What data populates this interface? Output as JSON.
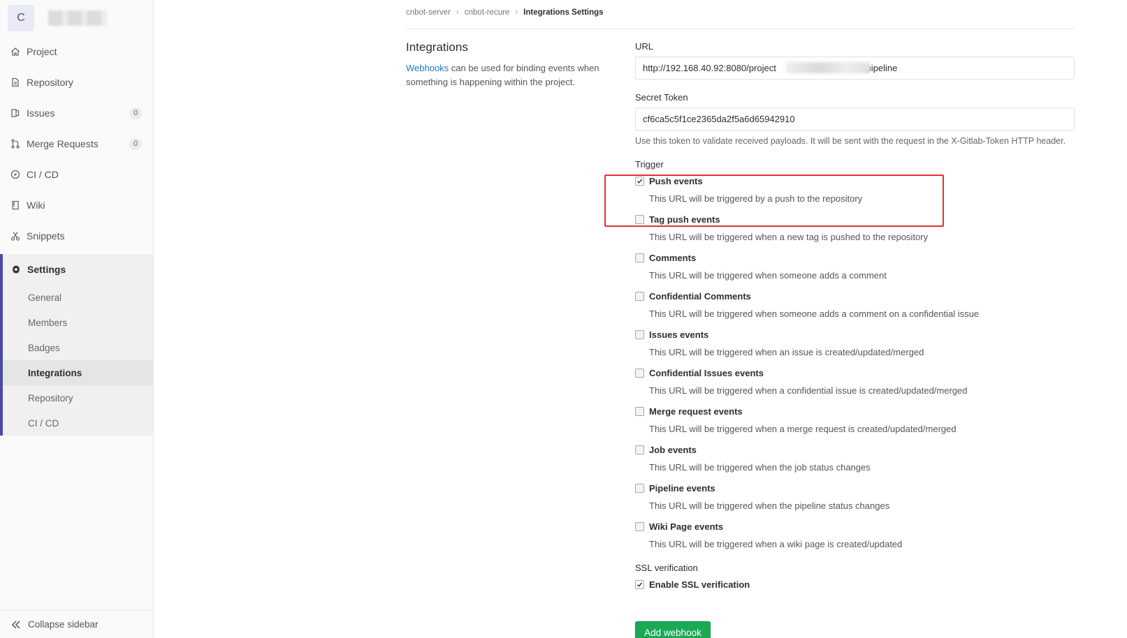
{
  "sidebar": {
    "avatar_letter": "C",
    "items": [
      {
        "label": "Project",
        "icon": "home-icon"
      },
      {
        "label": "Repository",
        "icon": "doc-icon"
      },
      {
        "label": "Issues",
        "icon": "issues-icon",
        "badge": "0"
      },
      {
        "label": "Merge Requests",
        "icon": "merge-icon",
        "badge": "0"
      },
      {
        "label": "CI / CD",
        "icon": "rocket-icon"
      },
      {
        "label": "Wiki",
        "icon": "book-icon"
      },
      {
        "label": "Snippets",
        "icon": "scissors-icon"
      }
    ],
    "settings": {
      "label": "Settings",
      "icon": "gear-icon",
      "sub_items": [
        "General",
        "Members",
        "Badges",
        "Integrations",
        "Repository",
        "CI / CD"
      ],
      "active_index": 3
    },
    "collapse_label": "Collapse sidebar"
  },
  "breadcrumb": [
    "cnbot-server",
    "cnbot-recure",
    "Integrations Settings"
  ],
  "intro": {
    "title": "Integrations",
    "link_text": "Webhooks",
    "description": " can be used for binding events when something is happening within the project."
  },
  "form": {
    "url_label": "URL",
    "url_value_prefix": "http://192.168.40.92:8080/project",
    "url_value_suffix": "r-pipeline",
    "token_label": "Secret Token",
    "token_value": "cf6ca5c5f1ce2365da2f5a6d65942910",
    "token_help": "Use this token to validate received payloads. It will be sent with the request in the X-Gitlab-Token HTTP header.",
    "trigger_label": "Trigger",
    "events": [
      {
        "title": "Push events",
        "desc": "This URL will be triggered by a push to the repository",
        "checked": true
      },
      {
        "title": "Tag push events",
        "desc": "This URL will be triggered when a new tag is pushed to the repository",
        "checked": false
      },
      {
        "title": "Comments",
        "desc": "This URL will be triggered when someone adds a comment",
        "checked": false
      },
      {
        "title": "Confidential Comments",
        "desc": "This URL will be triggered when someone adds a comment on a confidential issue",
        "checked": false
      },
      {
        "title": "Issues events",
        "desc": "This URL will be triggered when an issue is created/updated/merged",
        "checked": false
      },
      {
        "title": "Confidential Issues events",
        "desc": "This URL will be triggered when a confidential issue is created/updated/merged",
        "checked": false
      },
      {
        "title": "Merge request events",
        "desc": "This URL will be triggered when a merge request is created/updated/merged",
        "checked": false
      },
      {
        "title": "Job events",
        "desc": "This URL will be triggered when the job status changes",
        "checked": false
      },
      {
        "title": "Pipeline events",
        "desc": "This URL will be triggered when the pipeline status changes",
        "checked": false
      },
      {
        "title": "Wiki Page events",
        "desc": "This URL will be triggered when a wiki page is created/updated",
        "checked": false
      }
    ],
    "ssl_label": "SSL verification",
    "ssl_option": "Enable SSL verification",
    "ssl_checked": true,
    "submit_label": "Add webhook"
  },
  "colors": {
    "accent_nav": "#4b4ba3",
    "link": "#1f78d1",
    "button": "#1aaa55",
    "highlight_box": "#e03131"
  }
}
